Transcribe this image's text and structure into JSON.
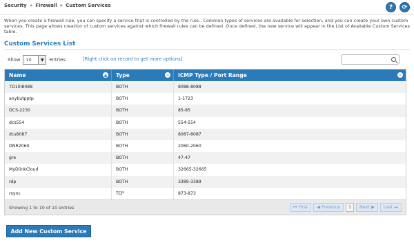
{
  "breadcrumb": [
    "Security",
    "Firewall",
    "Custom Services"
  ],
  "breadcrumb_separator": "»",
  "icons": {
    "help": "?",
    "logout": "⟳"
  },
  "intro": "When you create a firewall rule, you can specify a service that is controlled by the rule.. Common types of services are available for selection, and you can create your own custom services. This page allows creation of custom services against which firewall rules can be defined. Once defined, the new service will appear in the List of Available Custom Services table.",
  "section_title": "Custom Services List",
  "controls": {
    "show_label": "Show",
    "page_size": "10",
    "entries_label": "entries",
    "right_click_hint": "[Right click on record to get more options]"
  },
  "table": {
    "columns": [
      "Name",
      "Type",
      "ICMP Type / Port Range"
    ],
    "rows": [
      [
        "7D10I8088",
        "BOTH",
        "8088-8088"
      ],
      [
        "anybutpptp",
        "BOTH",
        "1-1723"
      ],
      [
        "DCS-2230",
        "BOTH",
        "85-85"
      ],
      [
        "dcs554",
        "BOTH",
        "554-554"
      ],
      [
        "dcs8087",
        "BOTH",
        "8087-8087"
      ],
      [
        "DNR2060",
        "BOTH",
        "2060-2060"
      ],
      [
        "gre",
        "BOTH",
        "47-47"
      ],
      [
        "MyDlinkCloud",
        "BOTH",
        "32665-32665"
      ],
      [
        "rdp",
        "BOTH",
        "3389-3389"
      ],
      [
        "rsync",
        "TCP",
        "873-873"
      ]
    ]
  },
  "footer": {
    "info": "Showing 1 to 10 of 10 entries",
    "pager": {
      "first": "First",
      "previous": "Previous",
      "current": "1",
      "next": "Next",
      "last": "Last"
    }
  },
  "add_button": "Add New Custom Service",
  "colors": {
    "accent": "#2b7bb9",
    "link": "#2a7db8"
  }
}
